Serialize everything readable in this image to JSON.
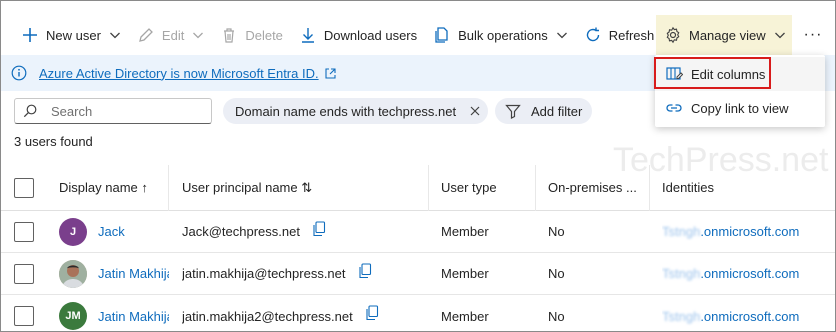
{
  "toolbar": {
    "new_user": "New user",
    "edit": "Edit",
    "delete": "Delete",
    "download_users": "Download users",
    "bulk_operations": "Bulk operations",
    "refresh": "Refresh",
    "manage_view": "Manage view",
    "more": "···"
  },
  "banner": {
    "text": "Azure Active Directory is now Microsoft Entra ID."
  },
  "manage_view_menu": {
    "items": [
      {
        "label": "Edit columns",
        "icon": "edit-columns-icon",
        "highlighted": true
      },
      {
        "label": "Copy link to view",
        "icon": "link-icon"
      }
    ]
  },
  "search": {
    "placeholder": "Search"
  },
  "filters": {
    "active": "Domain name ends with techpress.net",
    "add_filter": "Add filter"
  },
  "result_count": "3 users found",
  "table": {
    "columns": [
      "Display name ↑",
      "User principal name ⇅",
      "User type",
      "On-premises ...",
      "Identities"
    ],
    "rows": [
      {
        "initials": "J",
        "avatar_color": "#7a3f8c",
        "display_name": "Jack",
        "upn": "Jack@techpress.net",
        "user_type": "Member",
        "on_premises": "No",
        "identity": ".onmicrosoft.com",
        "identity_blurred": "Tstngh"
      },
      {
        "initials": "",
        "avatar_color": "#8a6b55",
        "display_name": "Jatin Makhija",
        "upn": "jatin.makhija@techpress.net",
        "user_type": "Member",
        "on_premises": "No",
        "identity": ".onmicrosoft.com",
        "identity_blurred": "Tstngh"
      },
      {
        "initials": "JM",
        "avatar_color": "#3b7a3d",
        "display_name": "Jatin Makhija",
        "upn": "jatin.makhija2@techpress.net",
        "user_type": "Member",
        "on_premises": "No",
        "identity": ".onmicrosoft.com",
        "identity_blurred": "Tstngh"
      }
    ]
  },
  "watermark": "TechPress.net",
  "colors": {
    "link": "#0f6cbd",
    "highlight_border": "#d81b1b",
    "banner_bg": "#ebf3fc"
  }
}
